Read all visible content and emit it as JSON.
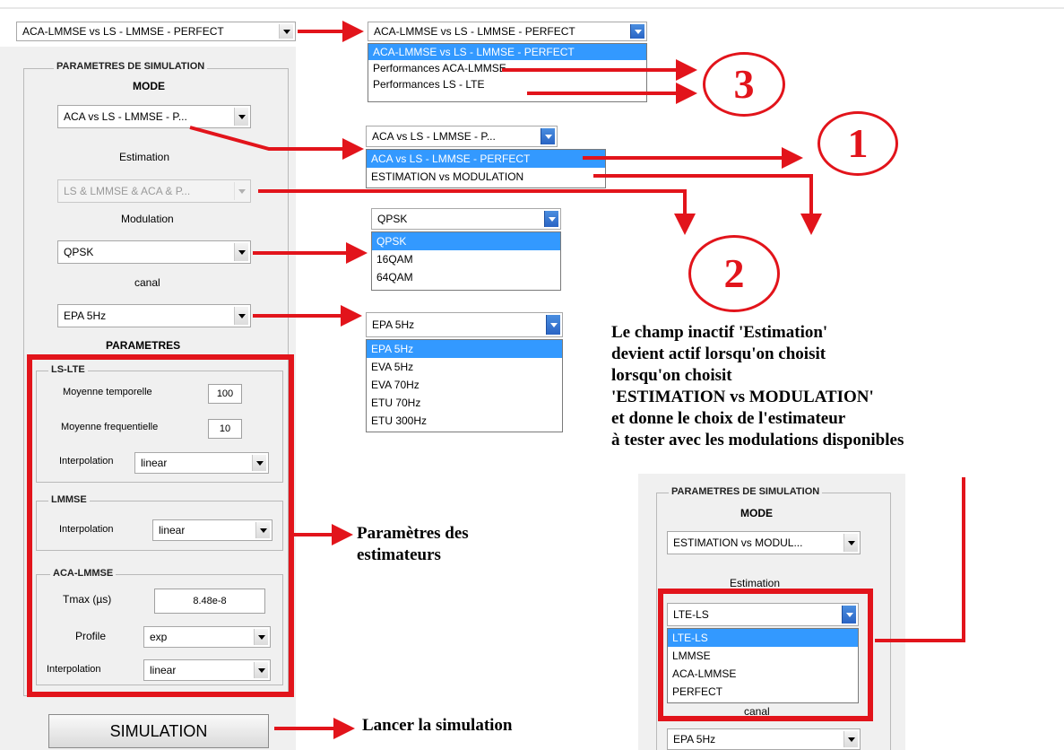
{
  "top_selector": {
    "value": "ACA-LMMSE vs LS - LMMSE - PERFECT"
  },
  "top_dropdown": {
    "value": "ACA-LMMSE vs LS - LMMSE - PERFECT",
    "options": [
      "ACA-LMMSE vs LS - LMMSE - PERFECT",
      "Performances ACA-LMMSE",
      "Performances LS - LTE"
    ],
    "selected_index": 0
  },
  "left_panel": {
    "group_title": "PARAMETRES DE SIMULATION",
    "mode_label": "MODE",
    "mode_value": "ACA vs LS - LMMSE - P...",
    "estimation_label": "Estimation",
    "estimation_value": "LS & LMMSE & ACA & P...",
    "modulation_label": "Modulation",
    "modulation_value": "QPSK",
    "canal_label": "canal",
    "canal_value": "EPA 5Hz",
    "parametres_label": "PARAMETRES",
    "ls_lte": {
      "title": "LS-LTE",
      "moyenne_temporelle_label": "Moyenne temporelle",
      "moyenne_temporelle_value": "100",
      "moyenne_frequentielle_label": "Moyenne frequentielle",
      "moyenne_frequentielle_value": "10",
      "interpolation_label": "Interpolation",
      "interpolation_value": "linear"
    },
    "lmmse": {
      "title": "LMMSE",
      "interpolation_label": "Interpolation",
      "interpolation_value": "linear"
    },
    "aca_lmmse": {
      "title": "ACA-LMMSE",
      "tmax_label": "Tmax (µs)",
      "tmax_value": "8.48e-8",
      "profile_label": "Profile",
      "profile_value": "exp",
      "interpolation_label": "Interpolation",
      "interpolation_value": "linear"
    },
    "simulation_button": "SIMULATION"
  },
  "mode_dropdown": {
    "value": "ACA vs LS - LMMSE - P...",
    "options": [
      "ACA vs LS - LMMSE - PERFECT",
      "ESTIMATION vs MODULATION"
    ],
    "selected_index": 0
  },
  "modulation_dropdown": {
    "value": "QPSK",
    "options": [
      "QPSK",
      "16QAM",
      "64QAM"
    ],
    "selected_index": 0
  },
  "canal_dropdown": {
    "value": "EPA 5Hz",
    "options": [
      "EPA 5Hz",
      "EVA 5Hz",
      "EVA 70Hz",
      "ETU 70Hz",
      "ETU 300Hz"
    ],
    "selected_index": 0
  },
  "markers": {
    "one": "1",
    "two": "2",
    "three": "3"
  },
  "annotations": {
    "estimation_note": [
      "Le champ inactif 'Estimation'",
      "devient actif lorsqu'on choisit",
      "lorsqu'on choisit",
      "'ESTIMATION vs MODULATION'",
      "et donne le choix de l'estimateur",
      "à tester avec les modulations disponibles"
    ],
    "estimators_note": [
      "Paramètres des",
      "estimateurs"
    ],
    "launch_note": "Lancer la simulation"
  },
  "right_panel": {
    "group_title": "PARAMETRES DE SIMULATION",
    "mode_label": "MODE",
    "mode_value": "ESTIMATION vs MODUL...",
    "estimation_label": "Estimation",
    "estimation_value": "LTE-LS",
    "estimation_options": [
      "LTE-LS",
      "LMMSE",
      "ACA-LMMSE",
      "PERFECT"
    ],
    "estimation_selected_index": 0,
    "canal_label": "canal",
    "canal_value": "EPA 5Hz"
  },
  "colors": {
    "annotation_red": "#e2141b",
    "selection_blue": "#3399ff"
  }
}
